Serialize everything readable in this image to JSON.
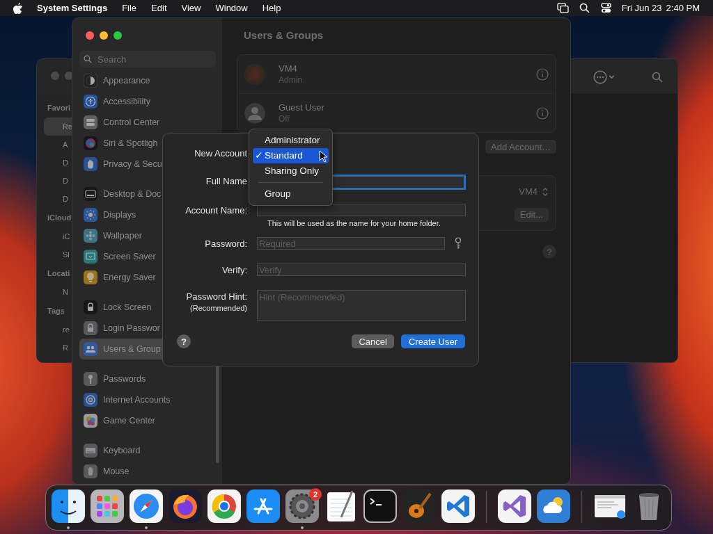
{
  "menu_bar": {
    "app": "System Settings",
    "menus": [
      "File",
      "Edit",
      "View",
      "Window",
      "Help"
    ],
    "date": "Fri Jun 23",
    "time": "2:40 PM"
  },
  "finder_window": {
    "sidebar": [
      {
        "heading": "Favori",
        "items": [
          {
            "label": "Re",
            "selected": true
          },
          {
            "label": "A",
            "selected": false
          },
          {
            "label": "D",
            "selected": false
          },
          {
            "label": "D",
            "selected": false
          },
          {
            "label": "D",
            "selected": false
          }
        ]
      },
      {
        "heading": "iCloud",
        "items": [
          {
            "label": "iC",
            "selected": false
          },
          {
            "label": "Sl",
            "selected": false
          }
        ]
      },
      {
        "heading": "Locati",
        "items": [
          {
            "label": "N",
            "selected": false
          }
        ]
      },
      {
        "heading": "Tags",
        "items": [
          {
            "label": "re",
            "selected": false
          },
          {
            "label": "R",
            "selected": false
          }
        ]
      }
    ]
  },
  "settings_window": {
    "search": {
      "placeholder": "Search"
    },
    "sidebar": [
      {
        "items": [
          {
            "label": "Appearance",
            "kind": "appearance",
            "selected": false
          },
          {
            "label": "Accessibility",
            "kind": "accessibility",
            "selected": false
          },
          {
            "label": "Control Center",
            "kind": "control-center",
            "selected": false
          },
          {
            "label": "Siri & Spotligh",
            "kind": "siri",
            "selected": false
          },
          {
            "label": "Privacy & Secu",
            "kind": "privacy",
            "selected": false
          }
        ]
      },
      {
        "items": [
          {
            "label": "Desktop & Doc",
            "kind": "desktop",
            "selected": false
          },
          {
            "label": "Displays",
            "kind": "displays",
            "selected": false
          },
          {
            "label": "Wallpaper",
            "kind": "wallpaper",
            "selected": false
          },
          {
            "label": "Screen Saver",
            "kind": "screen-saver",
            "selected": false
          },
          {
            "label": "Energy Saver",
            "kind": "energy",
            "selected": false
          }
        ]
      },
      {
        "items": [
          {
            "label": "Lock Screen",
            "kind": "lock-screen",
            "selected": false
          },
          {
            "label": "Login Passwor",
            "kind": "login-password",
            "selected": false
          },
          {
            "label": "Users & Group",
            "kind": "users",
            "selected": true
          }
        ]
      },
      {
        "items": [
          {
            "label": "Passwords",
            "kind": "passwords",
            "selected": false
          },
          {
            "label": "Internet Accounts",
            "kind": "internet",
            "selected": false
          },
          {
            "label": "Game Center",
            "kind": "game-center",
            "selected": false
          }
        ]
      },
      {
        "items": [
          {
            "label": "Keyboard",
            "kind": "keyboard",
            "selected": false
          },
          {
            "label": "Mouse",
            "kind": "mouse",
            "selected": false
          }
        ]
      }
    ],
    "title": "Users & Groups",
    "users": [
      {
        "name": "VM4",
        "role": "Admin",
        "kind": "photo"
      },
      {
        "name": "Guest User",
        "role": "Off",
        "kind": "guest"
      }
    ],
    "add_account_button": "Add Account…",
    "auto_login": {
      "value": "VM4",
      "edit_button": "Edit..."
    },
    "help": "?"
  },
  "dialog": {
    "fields": [
      {
        "kind": "popup",
        "label": "New Account"
      },
      {
        "kind": "text",
        "label": "Full Name",
        "focused": true
      },
      {
        "kind": "text",
        "label": "Account Name:",
        "focused": false,
        "note": "This will be used as the name for your home folder."
      },
      {
        "kind": "password",
        "label": "Password:",
        "placeholder": "Required",
        "focused": false
      },
      {
        "kind": "text",
        "label": "Verify:",
        "placeholder": "Verify",
        "focused": false
      },
      {
        "kind": "multiline",
        "label": "Password Hint:",
        "sublabel": "(Recommended)",
        "placeholder": "Hint (Recommended)",
        "focused": false
      }
    ],
    "menu": {
      "sections": [
        [
          {
            "label": "Administrator",
            "selected": false
          },
          {
            "label": "Standard",
            "selected": true
          },
          {
            "label": "Sharing Only",
            "selected": false
          }
        ],
        [
          {
            "label": "Group",
            "selected": false
          }
        ]
      ],
      "check": "✓"
    },
    "help": "?",
    "cancel": "Cancel",
    "create": "Create User"
  },
  "dock": {
    "items": [
      {
        "kind": "finder",
        "running": true
      },
      {
        "kind": "launchpad",
        "running": false
      },
      {
        "kind": "safari",
        "running": true
      },
      {
        "kind": "firefox",
        "running": false
      },
      {
        "kind": "chrome",
        "running": false
      },
      {
        "kind": "app-store",
        "running": false
      },
      {
        "kind": "settings",
        "running": true,
        "badge": "2"
      },
      {
        "kind": "textedit",
        "running": false
      },
      {
        "kind": "terminal",
        "running": false
      },
      {
        "kind": "garageband",
        "running": false
      },
      {
        "kind": "vscode",
        "running": false
      },
      {
        "kind": "divider"
      },
      {
        "kind": "visual-studio",
        "running": false
      },
      {
        "kind": "weather",
        "running": false
      },
      {
        "kind": "divider"
      },
      {
        "kind": "screenshot",
        "running": false
      },
      {
        "kind": "trash",
        "running": false
      }
    ]
  }
}
